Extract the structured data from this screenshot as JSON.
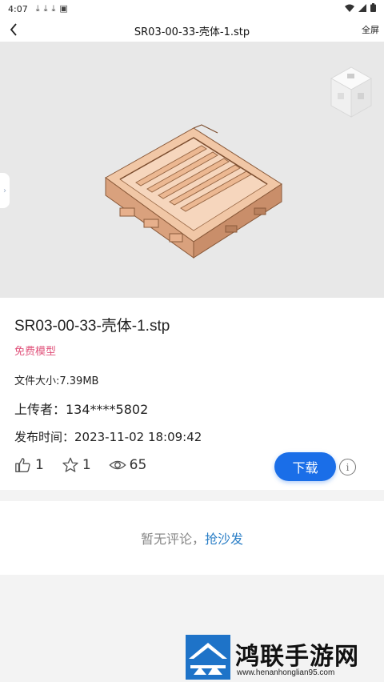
{
  "status_bar": {
    "time": "4:07",
    "icons_left": [
      "download-icon",
      "download-icon",
      "download-icon",
      "app-icon"
    ],
    "icons_right": [
      "wifi-icon",
      "signal-icon",
      "battery-icon"
    ]
  },
  "nav": {
    "back_icon": "chevron-left-icon",
    "title": "SR03-00-33-壳体-1.stp",
    "fullscreen_label": "全屏"
  },
  "viewer": {
    "background": "#e8e8e8",
    "model_color": "#e9b896"
  },
  "file": {
    "title": "SR03-00-33-壳体-1.stp",
    "tag": "免费模型",
    "size": "文件大小:7.39MB",
    "uploader": "上传者：134****5802",
    "publish_time": "发布时间：2023-11-02 18:09:42"
  },
  "stats": {
    "likes": "1",
    "favorites": "1",
    "views": "65"
  },
  "actions": {
    "download_label": "下载",
    "info_label": "i"
  },
  "comments": {
    "empty_text": "暂无评论，",
    "sofa_link": "抢沙发"
  },
  "watermark": {
    "text": "鸿联手游网",
    "url": "www.henanhonglian95.com"
  },
  "colors": {
    "accent": "#1a6ee8",
    "tag": "#e0537b",
    "link": "#2a7ec6"
  }
}
